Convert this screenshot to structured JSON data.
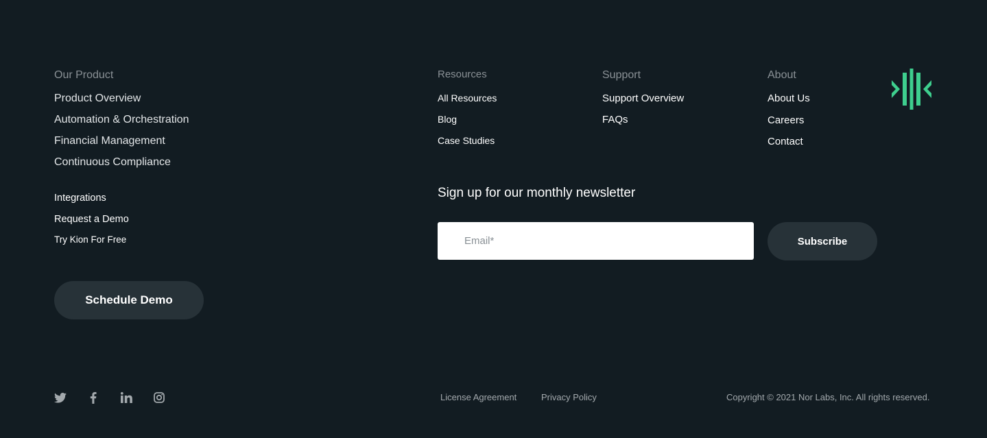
{
  "product": {
    "heading": "Our Product",
    "links": [
      "Product Overview",
      "Automation & Orchestration",
      "Financial Management",
      "Continuous Compliance"
    ],
    "secondary_links": [
      "Integrations",
      "Request a Demo",
      "Try Kion For Free"
    ],
    "cta_label": "Schedule Demo"
  },
  "resources": {
    "heading": "Resources",
    "links": [
      "All Resources",
      "Blog",
      "Case Studies"
    ]
  },
  "support": {
    "heading": "Support",
    "links": [
      "Support Overview",
      "FAQs"
    ]
  },
  "about": {
    "heading": "About",
    "links": [
      "About Us",
      "Careers",
      "Contact"
    ]
  },
  "logo": {
    "icon": "kion-logo-icon",
    "color": "#3ecf8e"
  },
  "newsletter": {
    "title": "Sign up for our monthly newsletter",
    "email_placeholder": "Email*",
    "email_value": "",
    "submit_label": "Subscribe"
  },
  "social": [
    {
      "icon": "twitter-icon"
    },
    {
      "icon": "facebook-icon"
    },
    {
      "icon": "linkedin-icon"
    },
    {
      "icon": "instagram-icon"
    }
  ],
  "legal": {
    "links": [
      "License Agreement",
      "Privacy Policy"
    ],
    "copyright": "Copyright © 2021 Nor Labs, Inc. All rights reserved."
  },
  "colors": {
    "background": "#121c22",
    "button": "#273238",
    "accent": "#3ecf8e",
    "muted_text": "#8a9196"
  }
}
